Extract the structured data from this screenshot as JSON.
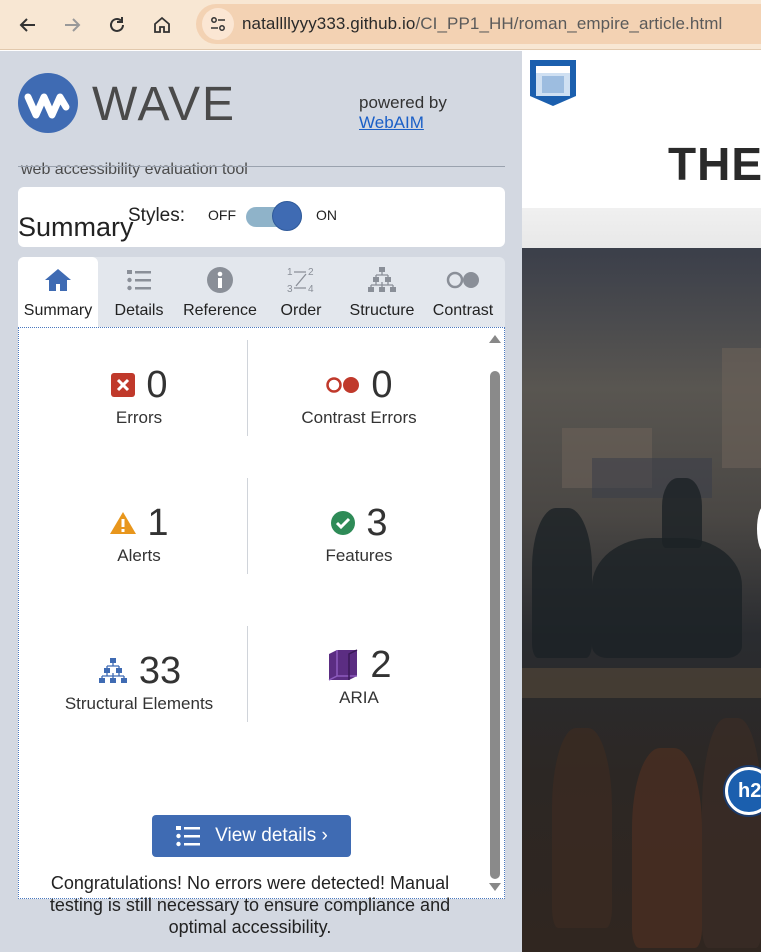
{
  "browser": {
    "url_host": "natallllyyy333.github.io",
    "url_path": "/CI_PP1_HH/roman_empire_article.html"
  },
  "wave": {
    "logo_word": "WAVE",
    "logo_subtitle": "web accessibility evaluation tool",
    "powered_by": "powered by",
    "powered_link": "WebAIM",
    "styles_label": "Styles:",
    "toggle_off": "OFF",
    "toggle_on": "ON",
    "toggle_state": "on",
    "section_title": "Summary",
    "tabs": [
      {
        "label": "Summary",
        "icon": "home-icon",
        "active": true
      },
      {
        "label": "Details",
        "icon": "list-icon",
        "active": false
      },
      {
        "label": "Reference",
        "icon": "info-icon",
        "active": false
      },
      {
        "label": "Order",
        "icon": "order-icon",
        "active": false
      },
      {
        "label": "Structure",
        "icon": "structure-icon",
        "active": false
      },
      {
        "label": "Contrast",
        "icon": "contrast-icon",
        "active": false
      }
    ],
    "stats": [
      {
        "count": "0",
        "label": "Errors",
        "icon": "error-icon"
      },
      {
        "count": "0",
        "label": "Contrast Errors",
        "icon": "contrast-error-icon"
      },
      {
        "count": "1",
        "label": "Alerts",
        "icon": "alert-icon"
      },
      {
        "count": "3",
        "label": "Features",
        "icon": "feature-icon"
      },
      {
        "count": "33",
        "label": "Structural Elements",
        "icon": "structure-icon"
      },
      {
        "count": "2",
        "label": "ARIA",
        "icon": "aria-icon"
      }
    ],
    "view_details": "View details ›",
    "congrats": "Congratulations! No errors were detected! Manual testing is still necessary to ensure compliance and optimal accessibility."
  },
  "page_preview": {
    "title": "THE",
    "badge": "h2"
  },
  "colors": {
    "wave_blue": "#3f6bb3",
    "error_red": "#c0392b",
    "alert_orange": "#e8961c",
    "feature_green": "#2e8b57",
    "aria_purple": "#5b2d82",
    "toolbar_bg": "#f8e7d3"
  }
}
